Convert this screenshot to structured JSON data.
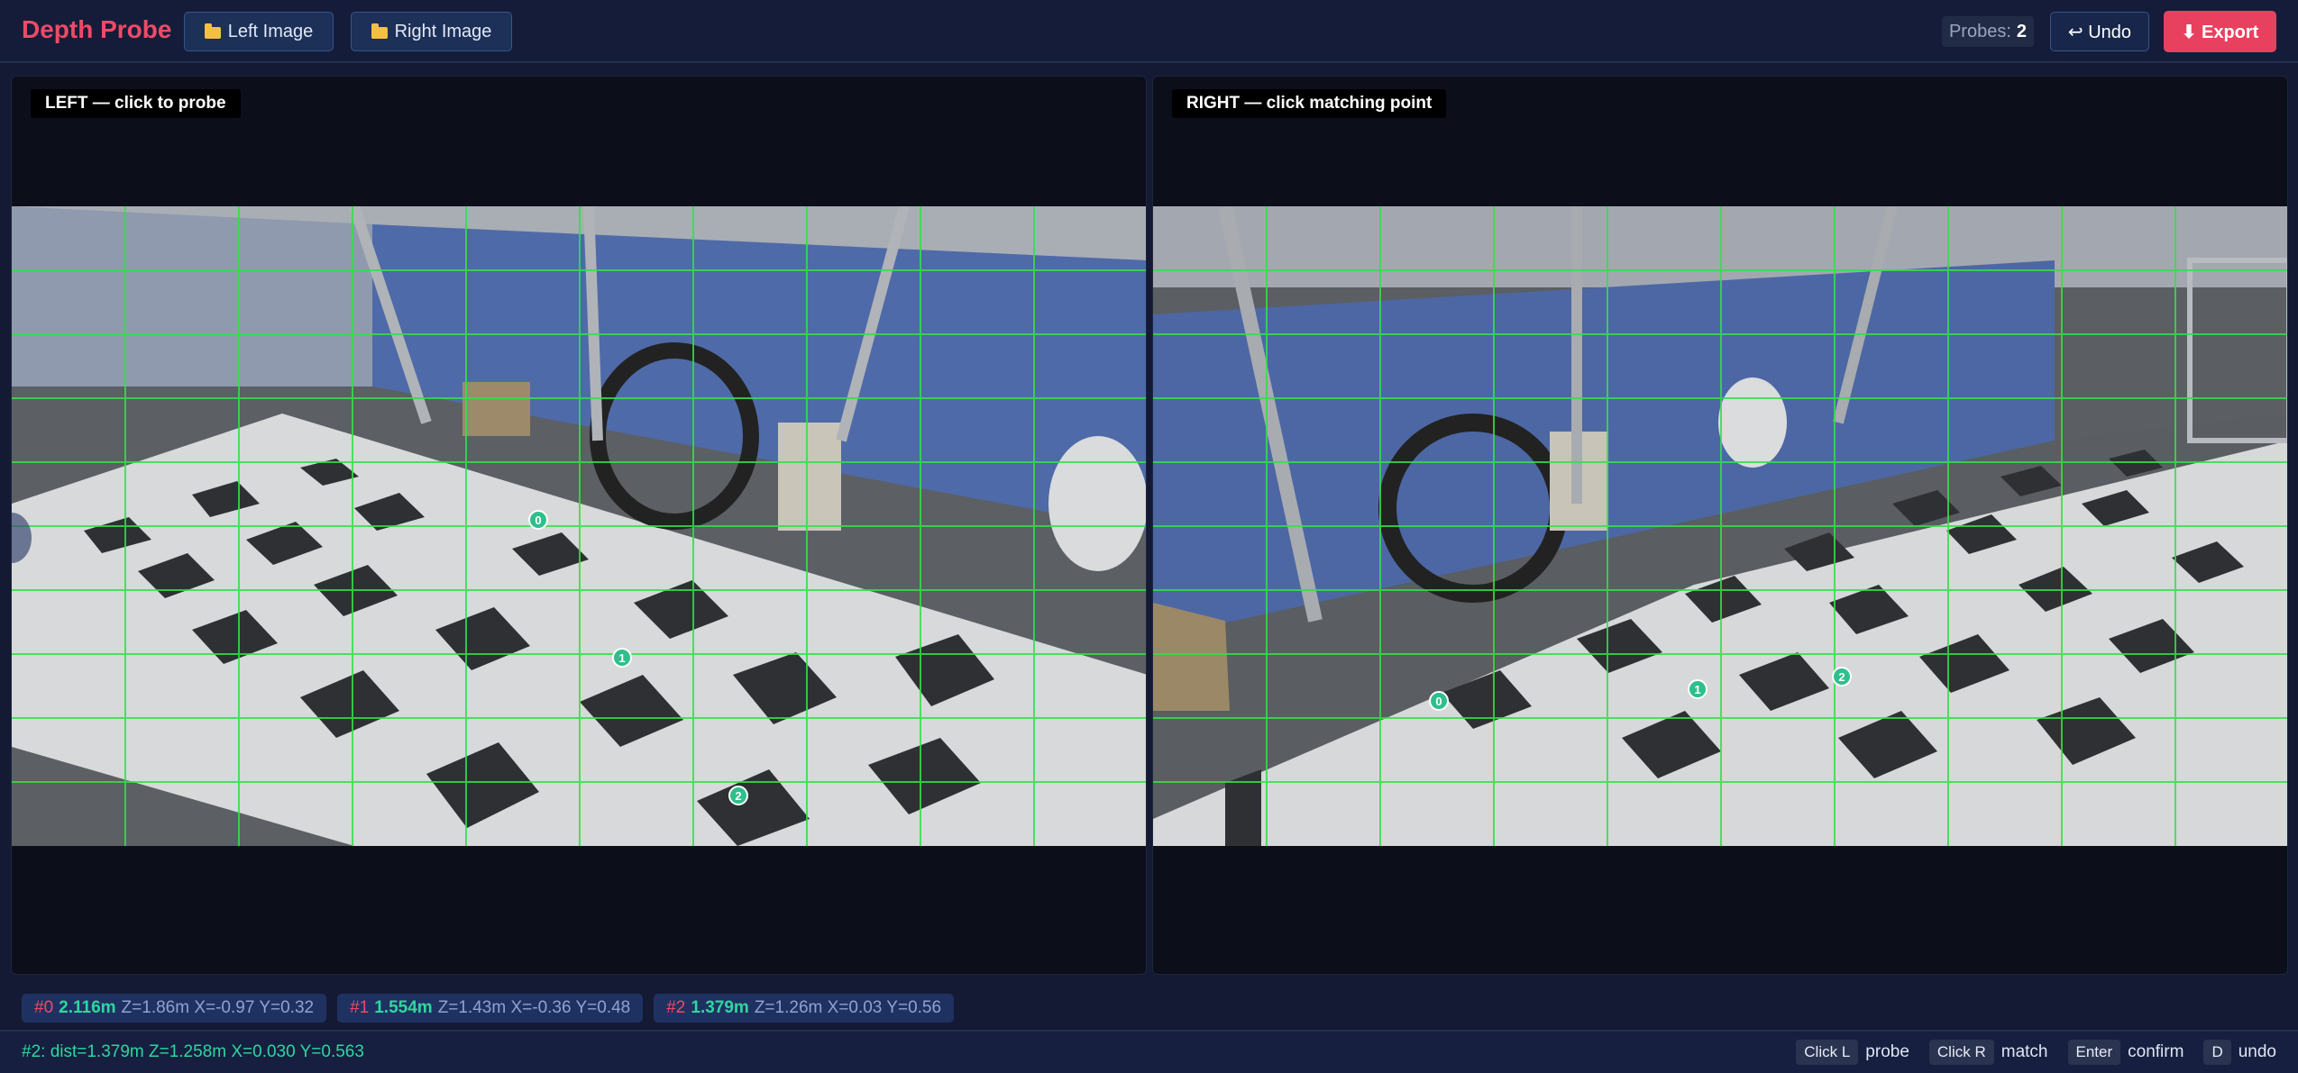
{
  "app": {
    "title": "Depth Probe"
  },
  "toolbar": {
    "left_image_label": "Left Image",
    "right_image_label": "Right Image",
    "probes_label": "Probes:",
    "probes_count": "2",
    "undo_label": "↩ Undo",
    "export_label": "⬇ Export"
  },
  "panels": {
    "left": {
      "label": "LEFT — click to probe"
    },
    "right": {
      "label": "RIGHT — click matching point"
    }
  },
  "markers": {
    "left": [
      "0",
      "1",
      "2"
    ],
    "right": [
      "0",
      "1",
      "2"
    ]
  },
  "chips": [
    {
      "id": "#0",
      "dist": "2.116m",
      "detail": "Z=1.86m X=-0.97 Y=0.32"
    },
    {
      "id": "#1",
      "dist": "1.554m",
      "detail": "Z=1.43m X=-0.36 Y=0.48"
    },
    {
      "id": "#2",
      "dist": "1.379m",
      "detail": "Z=1.26m X=0.03 Y=0.56"
    }
  ],
  "status": {
    "text": "#2: dist=1.379m Z=1.258m X=0.030 Y=0.563"
  },
  "shortcuts": [
    {
      "key": "Click L",
      "action": "probe"
    },
    {
      "key": "Click R",
      "action": "match"
    },
    {
      "key": "Enter",
      "action": "confirm"
    },
    {
      "key": "D",
      "action": "undo"
    }
  ],
  "colors": {
    "accent": "#ee4a67",
    "probe_marker": "#2fbf8c",
    "distance_text": "#2fd6a0",
    "grid_overlay": "#33e04a"
  }
}
